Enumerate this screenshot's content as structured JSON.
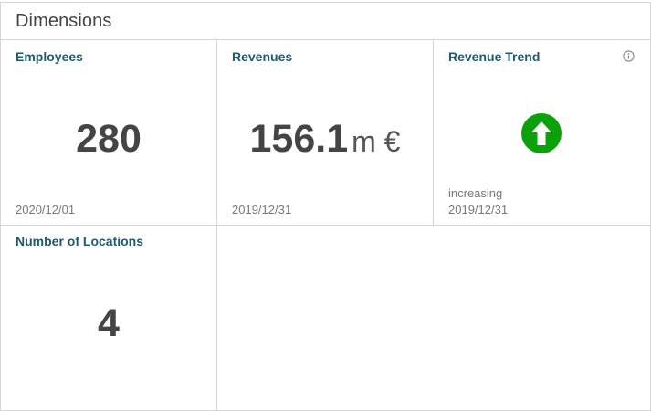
{
  "panel": {
    "title": "Dimensions"
  },
  "tiles": {
    "employees": {
      "title": "Employees",
      "value": "280",
      "date": "2020/12/01"
    },
    "revenues": {
      "title": "Revenues",
      "value": "156.1",
      "unit": "m €",
      "date": "2019/12/31"
    },
    "revenue_trend": {
      "title": "Revenue Trend",
      "icon": "arrow-up-circle-icon",
      "status": "increasing",
      "date": "2019/12/31",
      "info_icon": "info-icon"
    },
    "locations": {
      "title": "Number of Locations",
      "value": "4"
    }
  },
  "colors": {
    "title_accent": "#1f5a6e",
    "trend_up": "#0aa10a",
    "border": "#d6d6d6"
  }
}
